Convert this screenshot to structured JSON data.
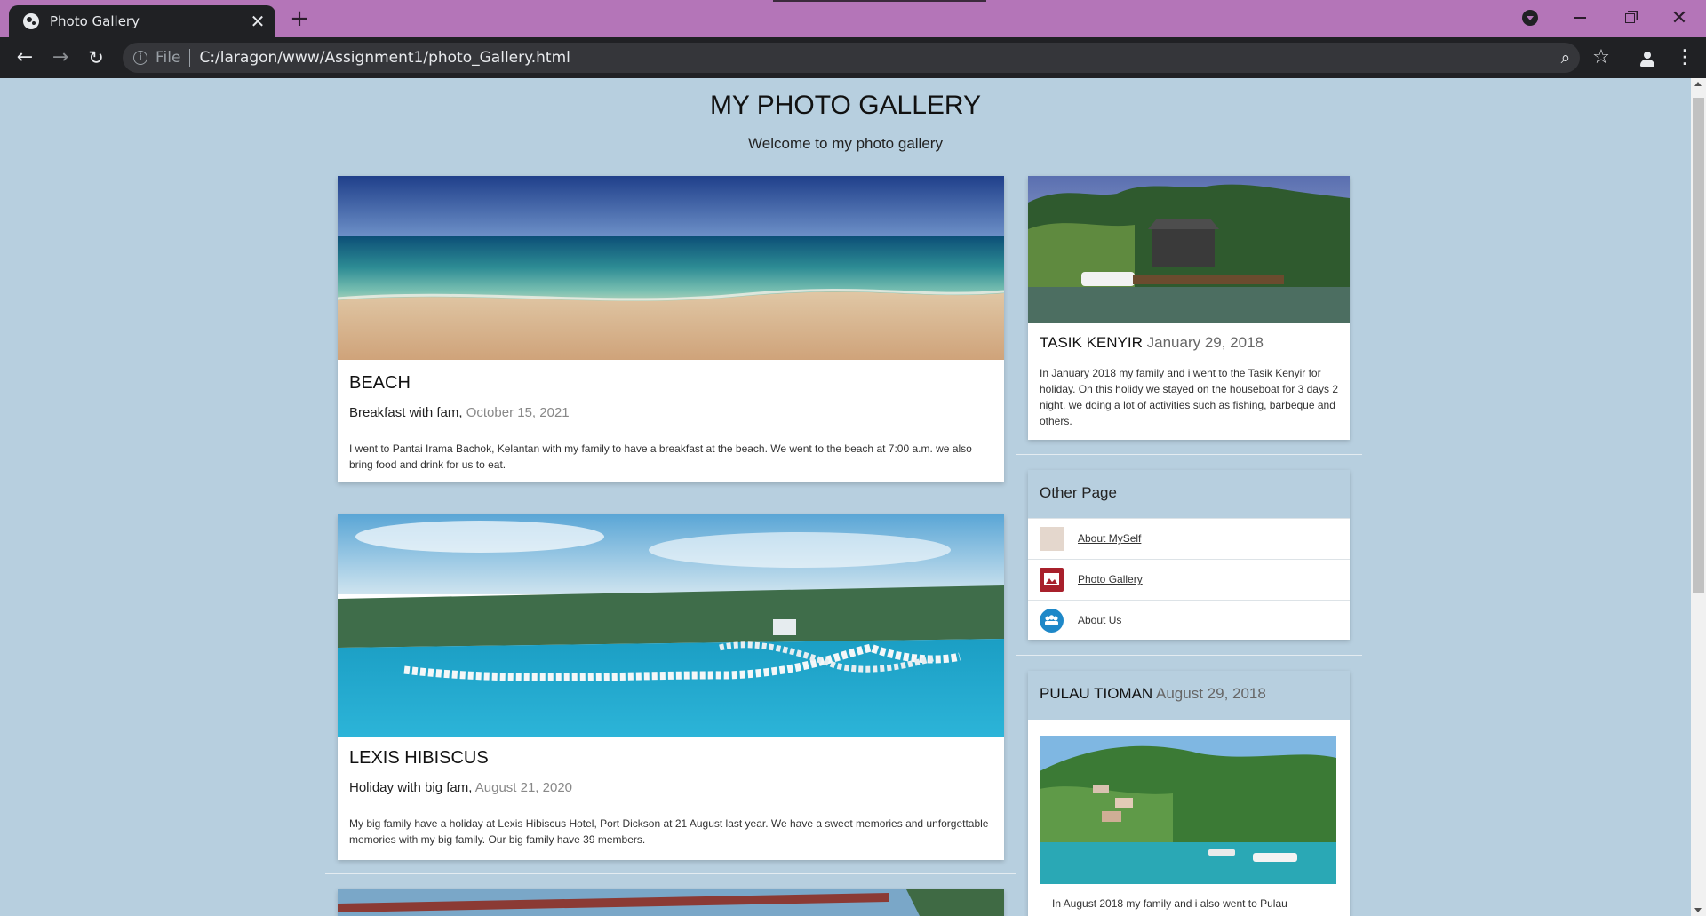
{
  "browser": {
    "tab_title": "Photo Gallery",
    "tab_close": "✕",
    "new_tab": "+",
    "url_scheme": "File",
    "url": "C:/laragon/www/Assignment1/photo_Gallery.html",
    "back": "←",
    "forward": "→",
    "reload": "↻",
    "zoom": "⌕",
    "star": "☆",
    "menu": "⋮",
    "close": "✕"
  },
  "page": {
    "title": "MY PHOTO GALLERY",
    "subtitle": "Welcome to my photo gallery"
  },
  "posts": [
    {
      "title": "BEACH",
      "subtitle": "Breakfast with fam,",
      "date": "October 15, 2021",
      "text": "I went to Pantai Irama Bachok, Kelantan with my family to have a breakfast at the beach. We went to the beach at 7:00 a.m. we also bring food and drink for us to eat."
    },
    {
      "title": "LEXIS HIBISCUS",
      "subtitle": "Holiday with big fam,",
      "date": "August 21, 2020",
      "text": "My big family have a holiday at Lexis Hibiscus Hotel, Port Dickson at 21 August last year. We have a sweet memories and unforgettable memories with my big family. Our big family have 39 members."
    }
  ],
  "sidebar": {
    "kenyir": {
      "title": "TASIK KENYIR",
      "date": "January 29, 2018",
      "text": "In January 2018 my family and i went to the Tasik Kenyir for holiday. On this holidy we stayed on the houseboat for 3 days 2 night. we doing a lot of activities such as fishing, barbeque and others."
    },
    "other_page": {
      "heading": "Other Page",
      "links": [
        {
          "label": "About MySelf",
          "icon": "portrait-thumbnail-icon"
        },
        {
          "label": "Photo Gallery",
          "icon": "gallery-icon"
        },
        {
          "label": "About Us",
          "icon": "group-icon"
        }
      ]
    },
    "tioman": {
      "title": "PULAU TIOMAN",
      "date": "August 29, 2018",
      "text": "In August 2018 my family and i also went to Pulau"
    }
  },
  "colors": {
    "page_background": "#b7cfdf",
    "tabbar": "#b475b8",
    "toolbar": "#202124"
  }
}
